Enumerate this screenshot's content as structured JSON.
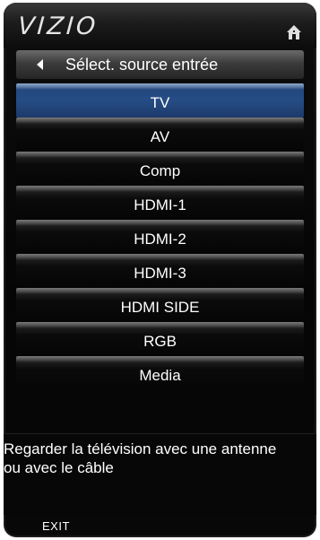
{
  "header": {
    "brand": "VIZIO",
    "home_icon": "home-icon"
  },
  "title_bar": {
    "back_icon": "left-triangle-icon",
    "title": "Sélect. source entrée"
  },
  "sources": {
    "selected_index": 0,
    "items": [
      {
        "label": "TV"
      },
      {
        "label": "AV"
      },
      {
        "label": "Comp"
      },
      {
        "label": "HDMI-1"
      },
      {
        "label": "HDMI-2"
      },
      {
        "label": "HDMI-3"
      },
      {
        "label": "HDMI SIDE"
      },
      {
        "label": "RGB"
      },
      {
        "label": "Media"
      }
    ]
  },
  "help": {
    "text": "Regarder la télévision avec une antenne ou avec le câble"
  },
  "footer": {
    "exit_label": "EXIT"
  },
  "colors": {
    "selected_highlight": "#274d86",
    "panel_background": "#050505",
    "text": "#ffffff"
  }
}
